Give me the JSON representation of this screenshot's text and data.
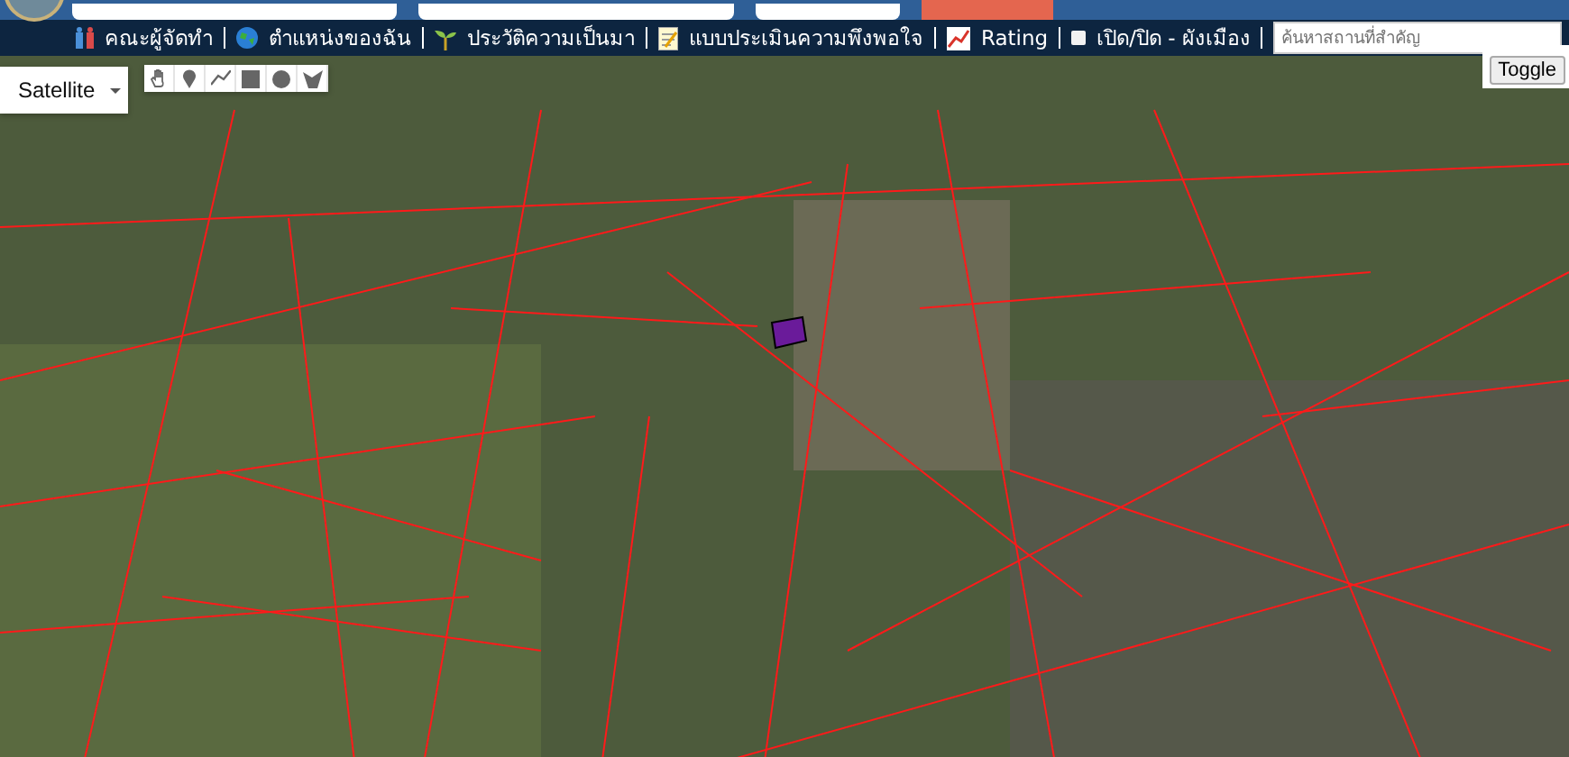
{
  "nav": {
    "items": [
      {
        "kind": "team",
        "label": "คณะผู้จัดทำ"
      },
      {
        "kind": "globe",
        "label": "ตำแหน่งของฉัน"
      },
      {
        "kind": "sprout",
        "label": "ประวัติความเป็นมา"
      },
      {
        "kind": "form",
        "label": "แบบประเมินความพึงพอใจ"
      },
      {
        "kind": "chart",
        "label": "Rating"
      },
      {
        "kind": "checkbox",
        "label": "เปิด/ปิด - ผังเมือง",
        "checked": false
      }
    ],
    "search": {
      "placeholder": "ค้นหาสถานที่สำคัญ"
    }
  },
  "map": {
    "type_control": {
      "label": "Satellite"
    },
    "tools": [
      {
        "kind": "hand",
        "selected": false
      },
      {
        "kind": "marker",
        "selected": false
      },
      {
        "kind": "line",
        "selected": false
      },
      {
        "kind": "rectangle",
        "selected": false
      },
      {
        "kind": "circle",
        "selected": false
      },
      {
        "kind": "polygon",
        "selected": false
      }
    ],
    "toggle_button": {
      "label": "Toggle"
    }
  }
}
